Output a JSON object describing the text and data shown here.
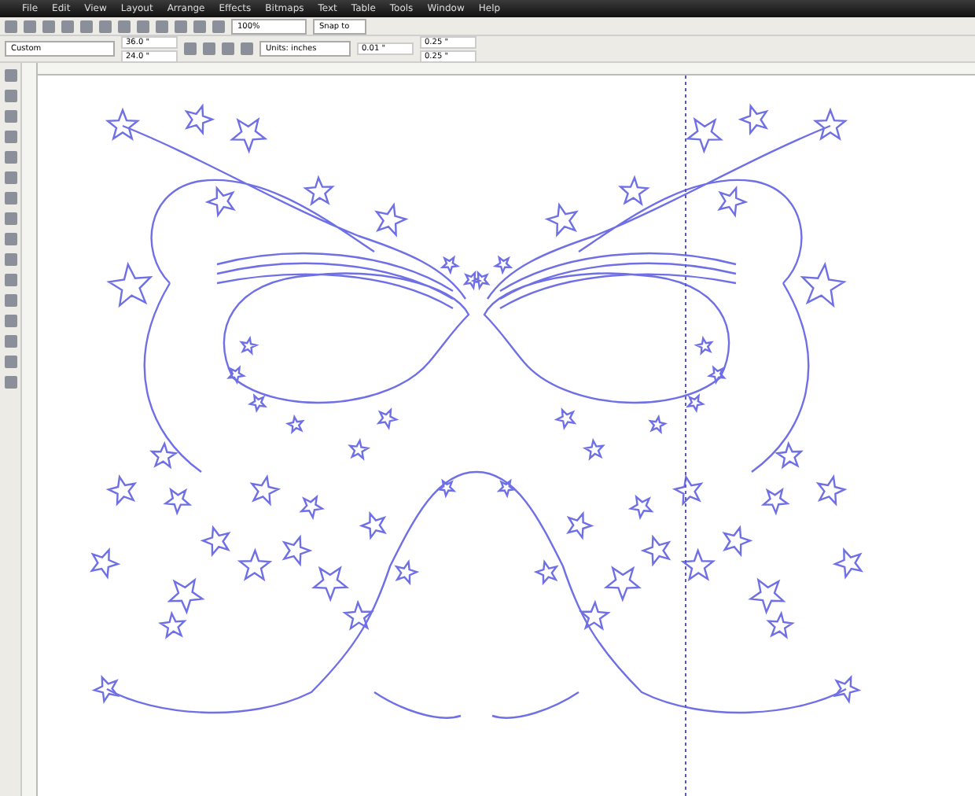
{
  "menu_bar": [
    "File",
    "Edit",
    "View",
    "Layout",
    "Arrange",
    "Effects",
    "Bitmaps",
    "Text",
    "Table",
    "Tools",
    "Window",
    "Help"
  ],
  "toolbar": {
    "zoom": "100%",
    "snap": "Snap to"
  },
  "property_bar": {
    "page_size": "Custom",
    "width": "36.0 \"",
    "height": "24.0 \"",
    "units": "Units: inches",
    "nudge": "0.01 \"",
    "duplicate_x": "0.25 \"",
    "duplicate_y": "0.25 \""
  }
}
